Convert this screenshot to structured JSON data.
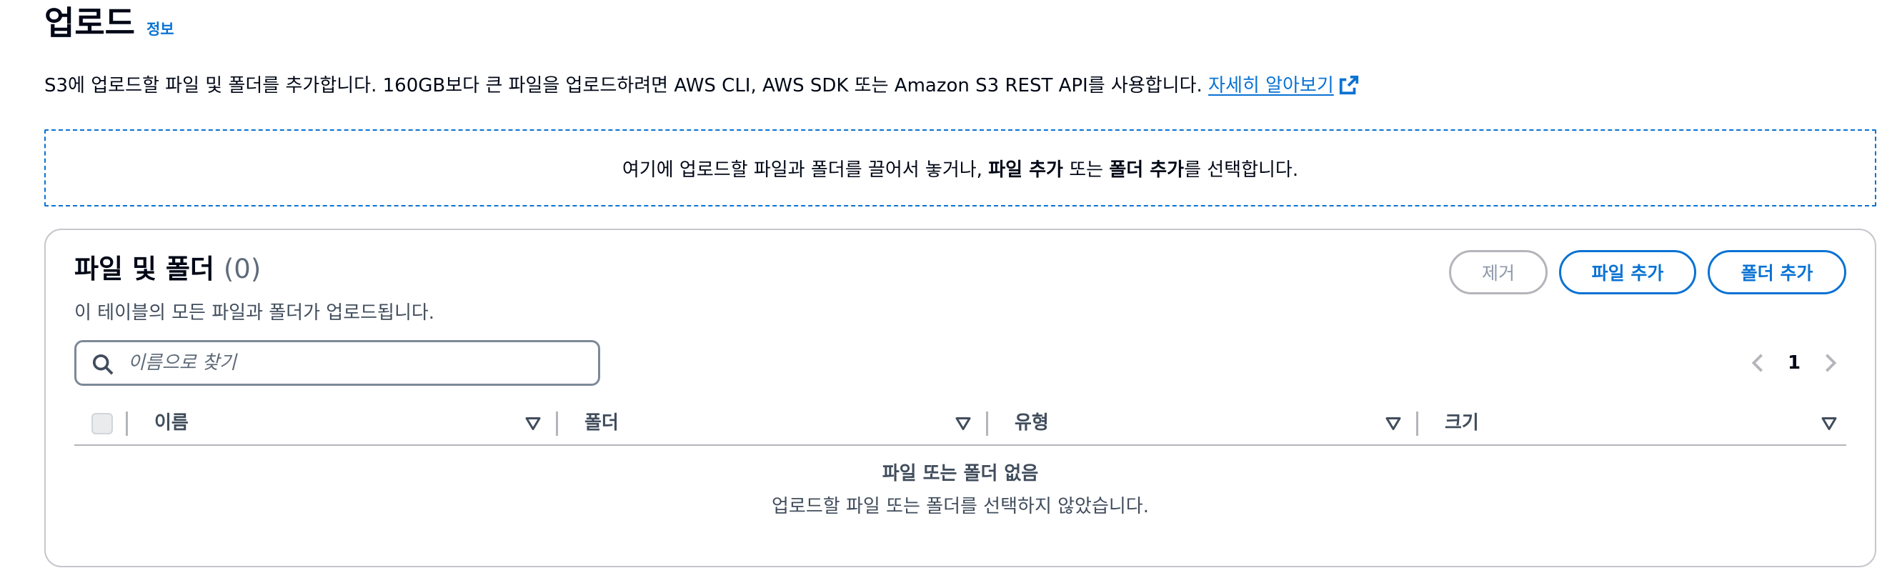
{
  "header": {
    "title": "업로드",
    "info_link": "정보"
  },
  "description": {
    "text": "S3에 업로드할 파일 및 폴더를 추가합니다. 160GB보다 큰 파일을 업로드하려면 AWS CLI, AWS SDK 또는 Amazon S3 REST API를 사용합니다.",
    "learn_more": "자세히 알아보기",
    "learn_more_icon": "external-link-icon"
  },
  "dropzone": {
    "part1": "여기에 업로드할 파일과 폴더를 끌어서 놓거나, ",
    "bold1": "파일 추가",
    "part2": " 또는 ",
    "bold2": "폴더 추가",
    "part3": "를 선택합니다."
  },
  "files_panel": {
    "title": "파일 및 폴더",
    "count": "(0)",
    "description": "이 테이블의 모든 파일과 폴더가 업로드됩니다.",
    "remove_label": "제거",
    "add_file_label": "파일 추가",
    "add_folder_label": "폴더 추가",
    "search_placeholder": "이름으로 찾기",
    "search_value": "",
    "current_page": "1",
    "columns": [
      "이름",
      "폴더",
      "유형",
      "크기"
    ],
    "empty_title": "파일 또는 폴더 없음",
    "empty_description": "업로드할 파일 또는 폴더를 선택하지 않았습니다."
  },
  "colors": {
    "accent": "#0972d3",
    "text": "#000716",
    "secondary_text": "#414d5c",
    "disabled": "#8d99a8"
  }
}
